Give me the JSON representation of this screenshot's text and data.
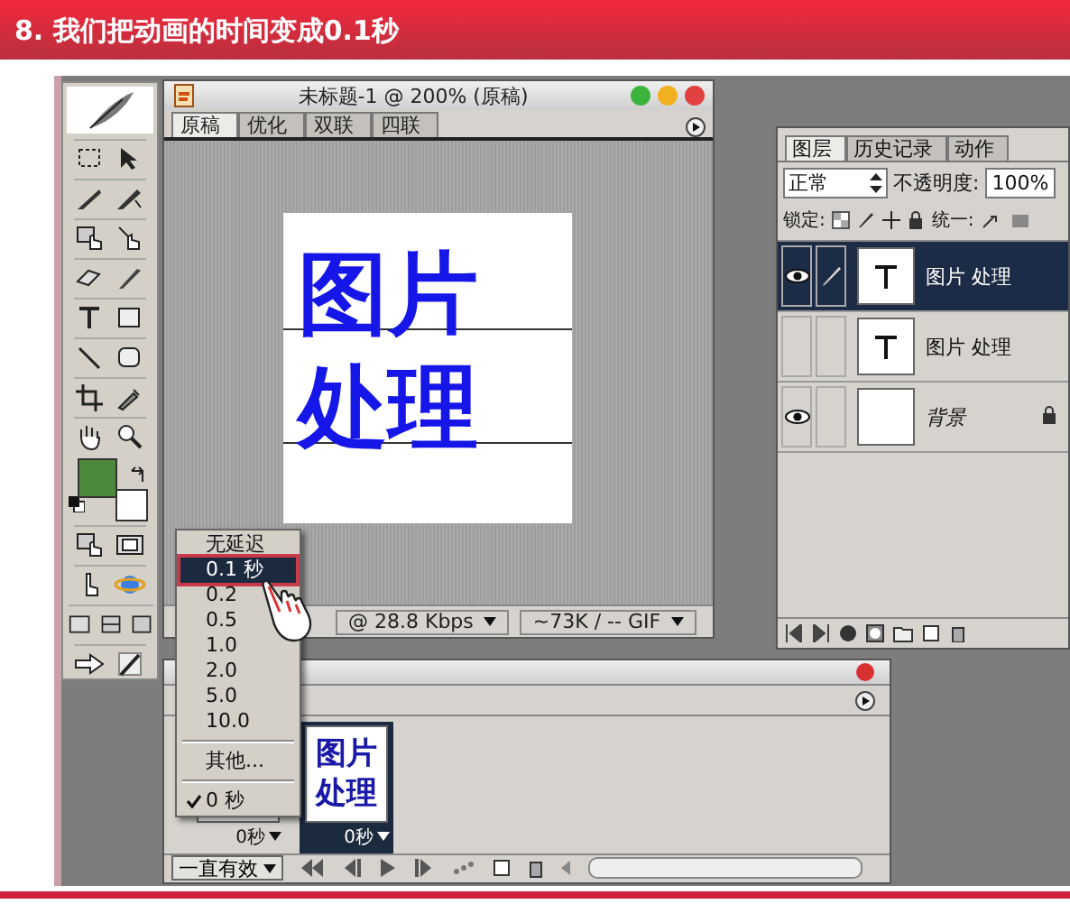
{
  "header": {
    "title": "8. 我们把动画的时间变成0.1秒"
  },
  "toolbox": {
    "swatches": [
      {
        "kind": "foreground",
        "color": "#4b8a3c"
      },
      {
        "kind": "background",
        "color": "#ffffff"
      }
    ]
  },
  "document": {
    "title": "未标题-1 @ 200% (原稿)",
    "tabs": [
      {
        "label": "原稿",
        "selected": true
      },
      {
        "label": "优化",
        "selected": false
      },
      {
        "label": "双联",
        "selected": false
      },
      {
        "label": "四联",
        "selected": false
      }
    ],
    "canvas_lines": [
      "图片",
      "处理"
    ],
    "status": [
      "@ 28.8 Kbps",
      "~73K / -- GIF"
    ]
  },
  "layers_panel": {
    "tabs": [
      {
        "label": "图层",
        "selected": true
      },
      {
        "label": "历史记录",
        "selected": false
      },
      {
        "label": "动作",
        "selected": false
      }
    ],
    "blend_mode": "正常",
    "opacity_label": "不透明度:",
    "opacity": "100%",
    "lock_label": "锁定:",
    "unify_label": "统一:",
    "layers": [
      {
        "name": "图片 处理",
        "kind": "text",
        "visible": true,
        "selected": true,
        "locked": false
      },
      {
        "name": "图片 处理",
        "kind": "text",
        "visible": false,
        "selected": false,
        "locked": false
      },
      {
        "name": "背景",
        "kind": "background",
        "visible": true,
        "selected": false,
        "locked": true
      }
    ]
  },
  "animation": {
    "frames": [
      {
        "delay": "0秒",
        "selected": false
      },
      {
        "delay": "0秒",
        "selected": true,
        "thumbnail_lines": [
          "图片",
          "处理"
        ]
      }
    ],
    "loop": "一直有效"
  },
  "delay_menu": {
    "items": [
      {
        "kind": "option",
        "label": "无延迟",
        "selected": false,
        "checked": false
      },
      {
        "kind": "option",
        "label": "0.1 秒",
        "selected": true,
        "checked": false
      },
      {
        "kind": "option",
        "label": "0.2",
        "selected": false,
        "checked": false
      },
      {
        "kind": "option",
        "label": "0.5",
        "selected": false,
        "checked": false
      },
      {
        "kind": "option",
        "label": "1.0",
        "selected": false,
        "checked": false
      },
      {
        "kind": "option",
        "label": "2.0",
        "selected": false,
        "checked": false
      },
      {
        "kind": "option",
        "label": "5.0",
        "selected": false,
        "checked": false
      },
      {
        "kind": "option",
        "label": "10.0",
        "selected": false,
        "checked": false
      },
      {
        "kind": "separator"
      },
      {
        "kind": "option",
        "label": "其他...",
        "selected": false,
        "checked": false
      },
      {
        "kind": "separator"
      },
      {
        "kind": "option",
        "label": "0 秒",
        "selected": false,
        "checked": true
      }
    ]
  }
}
